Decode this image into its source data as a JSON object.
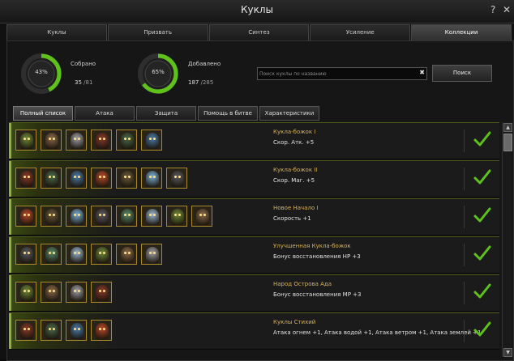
{
  "window": {
    "title": "Куклы",
    "help_label": "?",
    "close_label": "✕"
  },
  "tabs": [
    {
      "label": "Куклы",
      "active": false
    },
    {
      "label": "Призвать",
      "active": false
    },
    {
      "label": "Синтез",
      "active": false
    },
    {
      "label": "Усиление",
      "active": false
    },
    {
      "label": "Коллекции",
      "active": true
    }
  ],
  "stats": {
    "collected": {
      "label": "Собрано",
      "percent_text": "43%",
      "percent": 43,
      "count": "35",
      "total": " /81"
    },
    "added": {
      "label": "Добавлено",
      "percent_text": "65%",
      "percent": 65,
      "count": "187",
      "total": " /285"
    }
  },
  "search": {
    "placeholder": "Поиск куклы по названию",
    "clear_icon": "close-icon",
    "button_label": "Поиск"
  },
  "filters": [
    {
      "label": "Полный список",
      "active": true
    },
    {
      "label": "Атака",
      "active": false
    },
    {
      "label": "Защита",
      "active": false
    },
    {
      "label": "Помощь в битве",
      "active": false
    },
    {
      "label": "Характеристики",
      "active": false
    }
  ],
  "colors": {
    "accent_green": "#5fc21a",
    "gold_text": "#d8b25a",
    "icon_border": "#a88a2a"
  },
  "collections": [
    {
      "name": "Кукла-божок I",
      "effect": "Скор. Атк. +5",
      "completed": true,
      "dolls": [
        "green-goblin-doll-icon",
        "blue-elf-doll-icon",
        "armored-beast-doll-icon",
        "red-demon-doll-icon",
        "ice-crystal-doll-icon",
        "horned-warrior-doll-icon"
      ]
    },
    {
      "name": "Кукла-божок II",
      "effect": "Скор. Маг. +5",
      "completed": true,
      "dolls": [
        "fire-spirit-doll-icon",
        "ice-spirit-doll-icon",
        "forest-dryad-doll-icon",
        "stone-golem-doll-icon",
        "red-demon-doll-icon",
        "white-haired-mage-doll-icon",
        "dark-knight-doll-icon"
      ]
    },
    {
      "name": "Новое Начало I",
      "effect": "Скорость +1",
      "completed": true,
      "dolls": [
        "horned-warrior-doll-icon",
        "armored-knight-doll-icon",
        "dark-warrior-doll-icon",
        "green-orb-doll-icon",
        "young-hero-doll-icon",
        "warrior-chief-doll-icon",
        "maiden-doll-icon",
        "shadow-knight-doll-icon"
      ]
    },
    {
      "name": "Улучшенная Кукла-божок",
      "effect": "Бонус восстановления HP +3",
      "completed": true,
      "dolls": [
        "green-goblin-doll-icon",
        "bearded-elder-doll-icon",
        "white-haired-mage-doll-icon",
        "red-beast-doll-icon",
        "ice-crystal-doll-icon",
        "red-demon-doll-icon"
      ]
    },
    {
      "name": "Народ Острова Ада",
      "effect": "Бонус восстановления MP +3",
      "completed": true,
      "dolls": [
        "red-brute-doll-icon",
        "bearded-elder-doll-icon",
        "blue-elf-doll-icon",
        "red-demon-doll-icon"
      ]
    },
    {
      "name": "Куклы Стихий",
      "effect": "Атака огнем +1, Атака водой +1, Атака ветром +1, Атака землей +1",
      "completed": true,
      "dolls": [
        "fire-spirit-doll-icon",
        "ice-spirit-doll-icon",
        "forest-dryad-doll-icon",
        "stone-golem-doll-icon"
      ]
    }
  ]
}
